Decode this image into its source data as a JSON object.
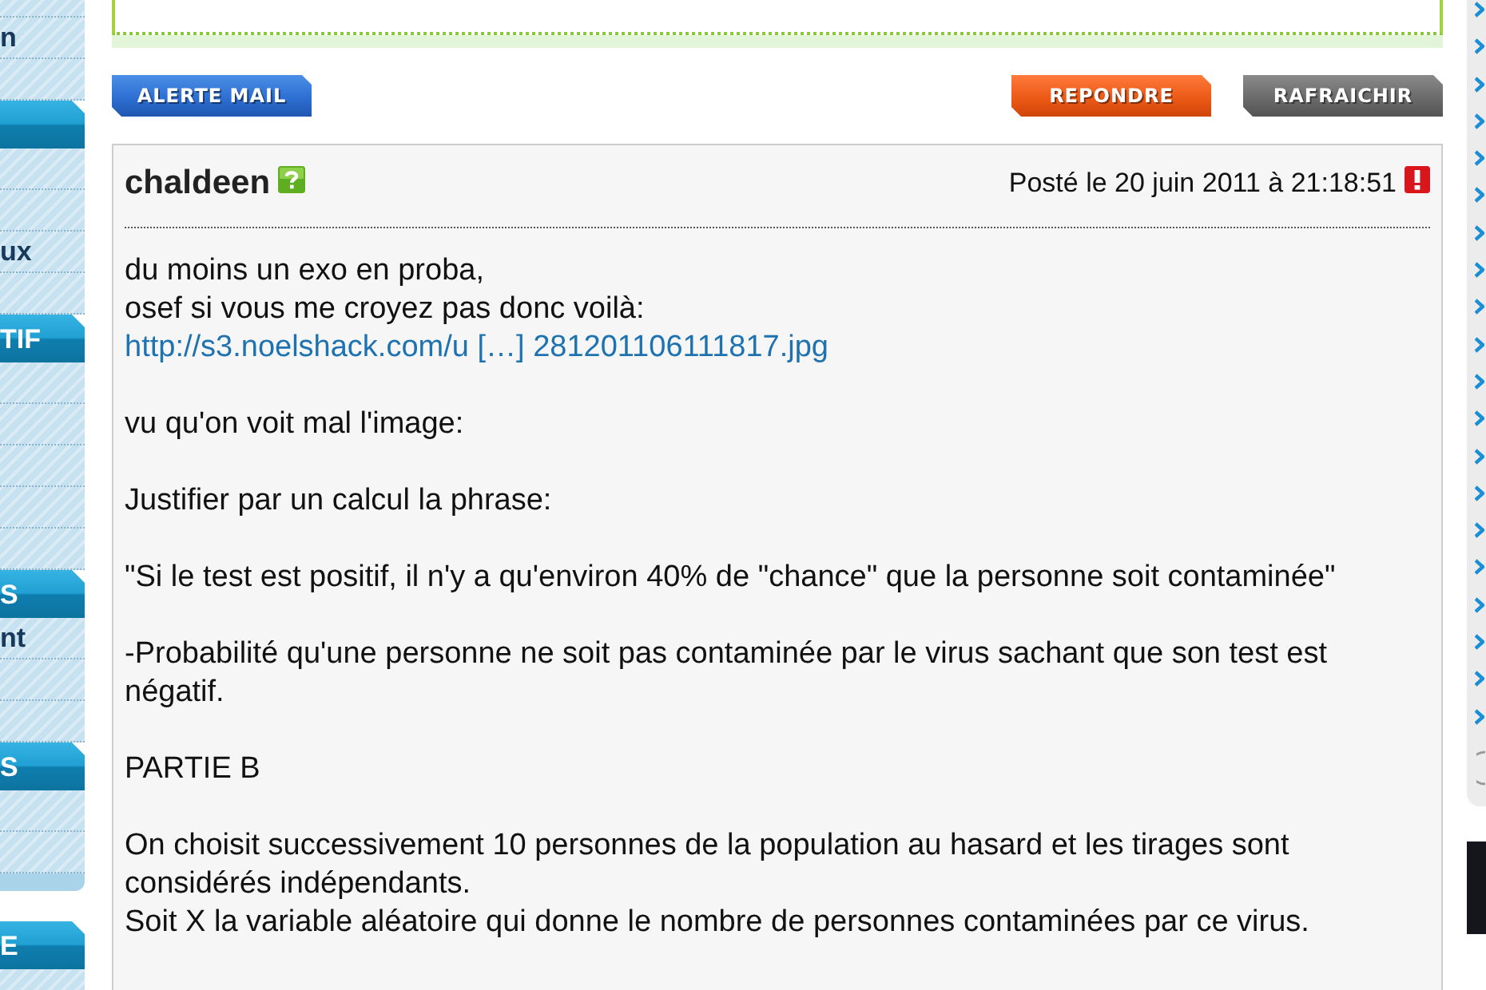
{
  "sidebar": {
    "blocks": [
      {
        "kind": "row",
        "label": "n"
      },
      {
        "kind": "row"
      },
      {
        "kind": "header"
      },
      {
        "kind": "row"
      },
      {
        "kind": "row"
      },
      {
        "kind": "row",
        "label": "ux"
      },
      {
        "kind": "row"
      },
      {
        "kind": "header",
        "label": "TIF"
      },
      {
        "kind": "row"
      },
      {
        "kind": "row"
      },
      {
        "kind": "row"
      },
      {
        "kind": "row"
      },
      {
        "kind": "row"
      },
      {
        "kind": "header",
        "label": "S"
      },
      {
        "kind": "row",
        "label": "nt"
      },
      {
        "kind": "row"
      },
      {
        "kind": "row"
      },
      {
        "kind": "header",
        "label": "S"
      },
      {
        "kind": "row"
      },
      {
        "kind": "row"
      },
      {
        "kind": "footer"
      },
      {
        "kind": "header",
        "label": "E"
      },
      {
        "kind": "row"
      }
    ]
  },
  "toolbar": {
    "buttons": [
      {
        "kind": "mail",
        "label": "ALERTE MAIL"
      },
      {
        "kind": "reply",
        "label": "REPONDRE"
      },
      {
        "kind": "refresh",
        "label": "RAFRAICHIR"
      }
    ]
  },
  "post": {
    "author": "chaldeen",
    "posted": "Posté le 20 juin 2011 à 21:18:51",
    "paragraphs": [
      [
        {
          "kind": "text",
          "text": "du moins un exo en proba,"
        },
        {
          "kind": "text",
          "text": "osef si vous me croyez pas donc voilà:"
        },
        {
          "kind": "link",
          "text": "http://s3.noelshack.com/u […] 281201106111817.jpg"
        }
      ],
      [
        {
          "kind": "text",
          "text": "vu qu'on voit mal l'image:"
        }
      ],
      [
        {
          "kind": "text",
          "text": "Justifier par un calcul la phrase:"
        }
      ],
      [
        {
          "kind": "text",
          "text": "\"Si le test est positif, il n'y a qu'environ 40% de \"chance\" que la personne soit contaminée\""
        }
      ],
      [
        {
          "kind": "text",
          "text": "-Probabilité qu'une personne ne soit pas contaminée par le virus sachant que son test est négatif."
        }
      ],
      [
        {
          "kind": "text",
          "text": "PARTIE B"
        }
      ],
      [
        {
          "kind": "text",
          "text": "On choisit successivement 10 personnes de la population au hasard et les tirages sont considérés indépendants."
        },
        {
          "kind": "text",
          "text": "Soit X la variable aléatoire qui donne le nombre de personnes contaminées par ce virus."
        }
      ]
    ]
  }
}
